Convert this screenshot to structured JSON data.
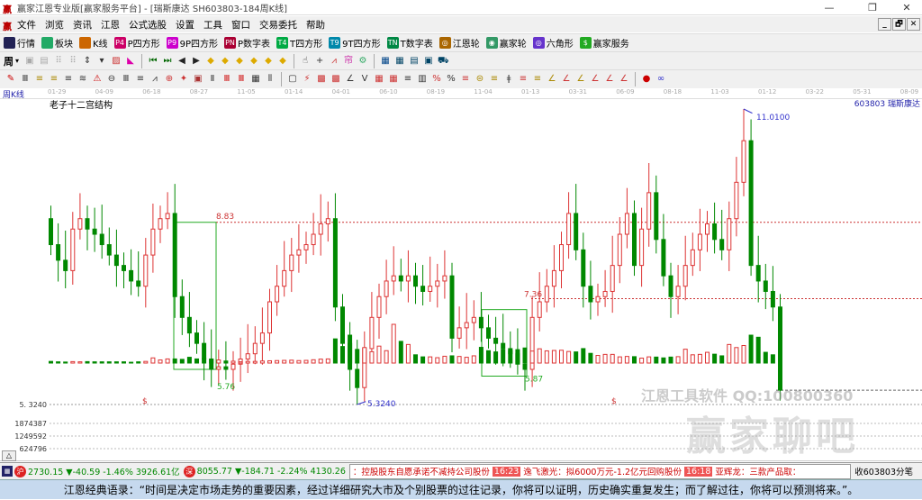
{
  "window": {
    "title": "赢家江恩专业版[赢家服务平台] - [瑞斯康达  SH603803-184周K线]",
    "min": "—",
    "max": "❐",
    "close": "✕"
  },
  "menu": [
    "文件",
    "浏览",
    "资讯",
    "江恩",
    "公式选股",
    "设置",
    "工具",
    "窗口",
    "交易委托",
    "帮助"
  ],
  "mdi": {
    "min": "_",
    "restore": "🗗",
    "close": "✕"
  },
  "toolbar1": [
    {
      "label": "行情",
      "icon": "grid-icon",
      "color": "#225"
    },
    {
      "label": "板块",
      "icon": "blocks-icon",
      "color": "#2a6"
    },
    {
      "label": "K线",
      "icon": "kline-icon",
      "color": "#c60"
    },
    {
      "label": "P四方形",
      "icon": "P4",
      "color": "#c06"
    },
    {
      "label": "9P四方形",
      "icon": "P9",
      "color": "#c0c"
    },
    {
      "label": "P数字表",
      "icon": "PN",
      "color": "#a03"
    },
    {
      "label": "T四方形",
      "icon": "T4",
      "color": "#0a4"
    },
    {
      "label": "9T四方形",
      "icon": "T9",
      "color": "#08a"
    },
    {
      "label": "T数字表",
      "icon": "TN",
      "color": "#084"
    },
    {
      "label": "江恩轮",
      "icon": "◎",
      "color": "#a60"
    },
    {
      "label": "赢家轮",
      "icon": "◉",
      "color": "#396"
    },
    {
      "label": "六角形",
      "icon": "◎",
      "color": "#63c"
    },
    {
      "label": "赢家服务",
      "icon": "$",
      "color": "#2a2"
    }
  ],
  "period_selector": "周",
  "chart_title": "老子十二宫结构",
  "period_label": "周K线",
  "stock_label": "603803  瑞斯康达",
  "watermark": {
    "line1": "江恩工具软件  QQ:100800360",
    "line2": "赢家聊吧"
  },
  "chart_data": {
    "type": "candlestick",
    "title": "老子十二宫结构",
    "date_ticks": [
      "01-29",
      "04-09",
      "06-18",
      "08-27",
      "11-05",
      "01-14",
      "04-01",
      "06-10",
      "08-19",
      "11-04",
      "01-13",
      "03-31",
      "06-09",
      "08-18",
      "11-03",
      "01-12",
      "03-22",
      "05-31",
      "08-09"
    ],
    "closes": [
      8.4,
      8.1,
      7.9,
      8.7,
      8.9,
      8.7,
      8.6,
      8.4,
      8.2,
      8.0,
      7.9,
      7.7,
      7.6,
      8.2,
      8.7,
      8.9,
      9.0,
      7.4,
      7.0,
      6.7,
      6.5,
      6.2,
      6.0,
      6.05,
      6.0,
      6.1,
      6.2,
      6.3,
      6.5,
      6.7,
      7.3,
      7.6,
      7.9,
      8.2,
      8.3,
      8.4,
      8.6,
      8.8,
      8.9,
      7.2,
      6.5,
      6.0,
      5.65,
      6.4,
      7.0,
      7.4,
      7.7,
      7.8,
      7.7,
      7.8,
      7.6,
      7.5,
      7.6,
      7.7,
      7.8,
      6.6,
      6.8,
      6.9,
      7.0,
      6.8,
      6.6,
      6.5,
      6.4,
      6.3,
      6.1,
      6.0,
      7.0,
      7.3,
      7.6,
      7.9,
      8.4,
      9.0,
      8.3,
      7.6,
      7.3,
      7.4,
      7.5,
      8.0,
      8.6,
      9.0,
      8.0,
      8.7,
      9.4,
      8.5,
      7.8,
      7.4,
      7.6,
      8.0,
      8.3,
      8.6,
      8.8,
      8.5,
      8.3,
      8.9,
      9.6,
      10.4,
      8.0,
      7.7,
      7.5,
      7.2,
      5.6
    ],
    "first_open": 8.9,
    "volumes": [
      80,
      60,
      50,
      70,
      60,
      70,
      60,
      60,
      60,
      60,
      60,
      40,
      60,
      80,
      250,
      150,
      200,
      200,
      180,
      280,
      200,
      220,
      180,
      150,
      100,
      90,
      60,
      80,
      80,
      100,
      110,
      120,
      130,
      140,
      120,
      130,
      160,
      190,
      200,
      1170,
      800,
      1350,
      660,
      750,
      550,
      820,
      600,
      1874,
      1050,
      900,
      400,
      300,
      300,
      260,
      330,
      350,
      320,
      280,
      350,
      760,
      600,
      540,
      650,
      610,
      650,
      730,
      580,
      690,
      590,
      610,
      620,
      560,
      540,
      700,
      470,
      370,
      420,
      420,
      300,
      320,
      310,
      240,
      300,
      290,
      250,
      290,
      310,
      670,
      400,
      420,
      520,
      430,
      350,
      900,
      750,
      850,
      1350,
      1250,
      520,
      400,
      360,
      300,
      350
    ],
    "volume_unit": "thousand shares",
    "volume_ticks": [
      "1874387",
      "1249592",
      "624796"
    ],
    "price_min_label": "5. 3240",
    "annotations": {
      "high": "11.0100",
      "low": "5.3240",
      "level1": "8.83",
      "level2": "7.36",
      "box1_low": "5.76",
      "box2_low": "5.87",
      "marker": "$"
    },
    "ylim": [
      5.324,
      11.01
    ]
  },
  "status": {
    "sh_label": "沪",
    "sh_quote": "2730.15 ▼-40.59 -1.46% 3926.61亿",
    "sz_label": "深",
    "sz_quote": "8055.77 ▼-184.71 -2.24% 4130.26",
    "news": [
      {
        "text": "：控股股东自愿承诺不减持公司股份"
      },
      {
        "tag": "16:23",
        "text": "逸飞激光：拟6000万元-1.2亿元回购股份"
      },
      {
        "tag": "16:18",
        "text": "亚辉龙：三款产品取："
      }
    ],
    "info": "收603803分笔"
  },
  "quote_text": "江恩经典语录：“时间是决定市场走势的重要因素，经过详细研究大市及个别股票的过往记录，你将可以证明，历史确实重复发生；而了解过往，你将可以预测将来。”。"
}
